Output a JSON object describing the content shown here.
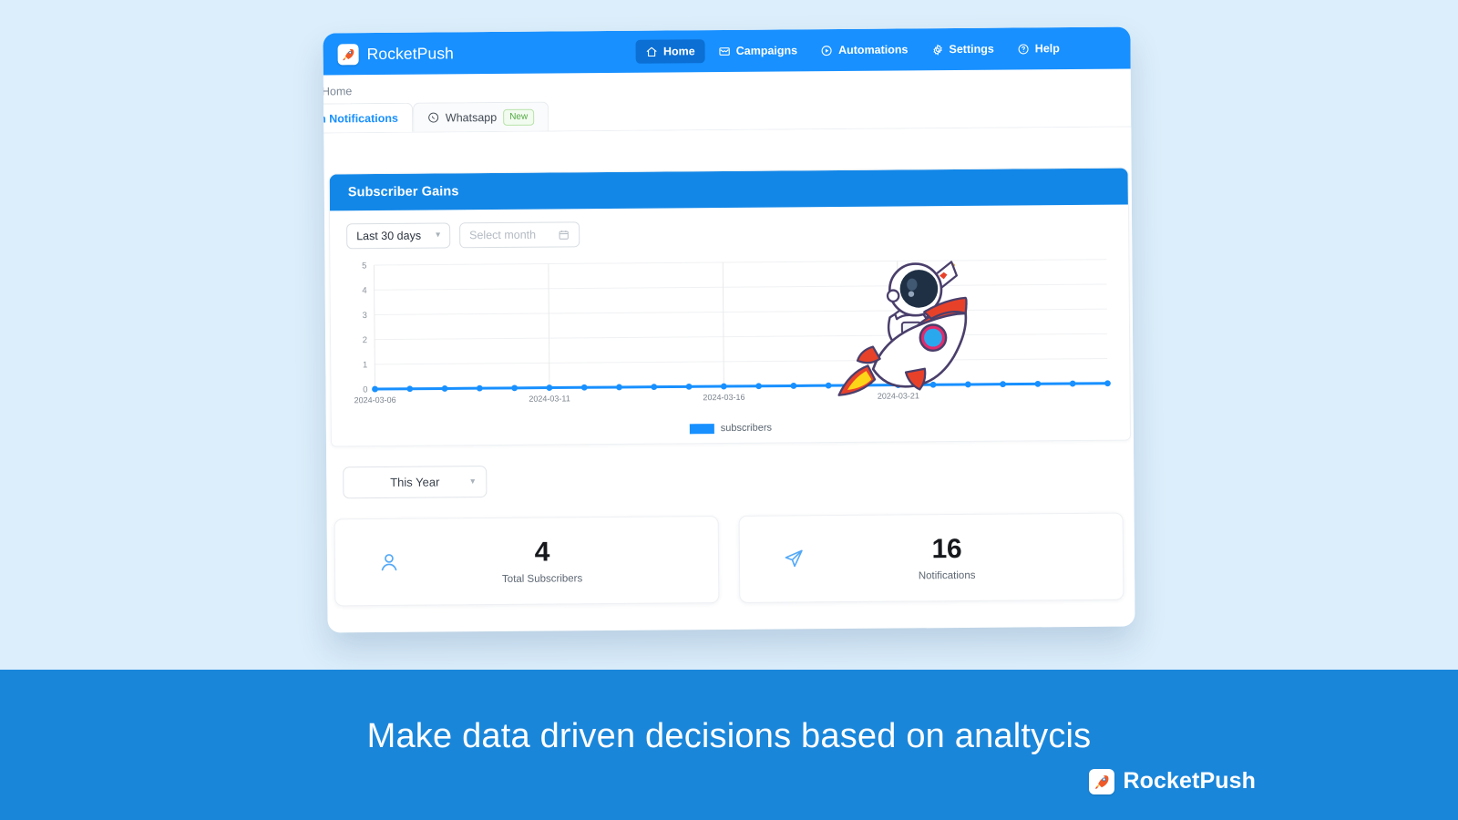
{
  "app": {
    "brand_name": "RocketPush",
    "brand_icon": "rocket-icon",
    "nav": [
      {
        "label": "Home",
        "icon": "home-icon",
        "active": true
      },
      {
        "label": "Campaigns",
        "icon": "envelope-icon",
        "active": false
      },
      {
        "label": "Automations",
        "icon": "play-icon",
        "active": false
      },
      {
        "label": "Settings",
        "icon": "gear-icon",
        "active": false
      },
      {
        "label": "Help",
        "icon": "question-icon",
        "active": false
      }
    ],
    "breadcrumb": "Home",
    "tabs": [
      {
        "label": "Push Notifications",
        "active": true,
        "badge": ""
      },
      {
        "label": "Whatsapp",
        "active": false,
        "badge": "New",
        "icon": "whatsapp-icon"
      }
    ]
  },
  "panel": {
    "title": "Subscriber Gains",
    "range_select": {
      "value": "Last 30 days",
      "icon": "chevron-down-icon"
    },
    "month_select": {
      "placeholder": "Select month",
      "icon": "calendar-icon"
    }
  },
  "year_select": {
    "value": "This Year",
    "icon": "chevron-down-icon"
  },
  "stats": [
    {
      "icon": "user-icon",
      "value": "4",
      "label": "Total Subscribers"
    },
    {
      "icon": "send-icon",
      "value": "16",
      "label": "Notifications"
    }
  ],
  "banner": {
    "text": "Make data driven decisions based on analtycis",
    "brand_name": "RocketPush",
    "brand_icon": "rocket-icon"
  },
  "colors": {
    "brand_blue": "#1890ff",
    "header_blue": "#1287e8",
    "active_nav": "#0b6fd4",
    "banner_blue": "#1a86da",
    "page_bg": "#dceefb",
    "series_blue": "#1890ff",
    "badge_green": "#52a844"
  },
  "chart_data": {
    "type": "line",
    "title": "Subscriber Gains",
    "xlabel": "",
    "ylabel": "",
    "ylim": [
      0,
      5
    ],
    "yticks": [
      0,
      1,
      2,
      3,
      4,
      5
    ],
    "grid": true,
    "legend_position": "bottom",
    "legend": [
      "subscribers"
    ],
    "xtick_labels": [
      "2024-03-06",
      "2024-03-11",
      "2024-03-16",
      "2024-03-21"
    ],
    "x": [
      "2024-03-06",
      "2024-03-07",
      "2024-03-08",
      "2024-03-09",
      "2024-03-10",
      "2024-03-11",
      "2024-03-12",
      "2024-03-13",
      "2024-03-14",
      "2024-03-15",
      "2024-03-16",
      "2024-03-17",
      "2024-03-18",
      "2024-03-19",
      "2024-03-20",
      "2024-03-21",
      "2024-03-22",
      "2024-03-23",
      "2024-03-24",
      "2024-03-25",
      "2024-03-26",
      "2024-03-27"
    ],
    "series": [
      {
        "name": "subscribers",
        "color": "#1890ff",
        "values": [
          0,
          0,
          0,
          0,
          0,
          0,
          0,
          0,
          0,
          0,
          0,
          0,
          0,
          0,
          0,
          0,
          0,
          0,
          0,
          0,
          0,
          0
        ]
      }
    ]
  }
}
